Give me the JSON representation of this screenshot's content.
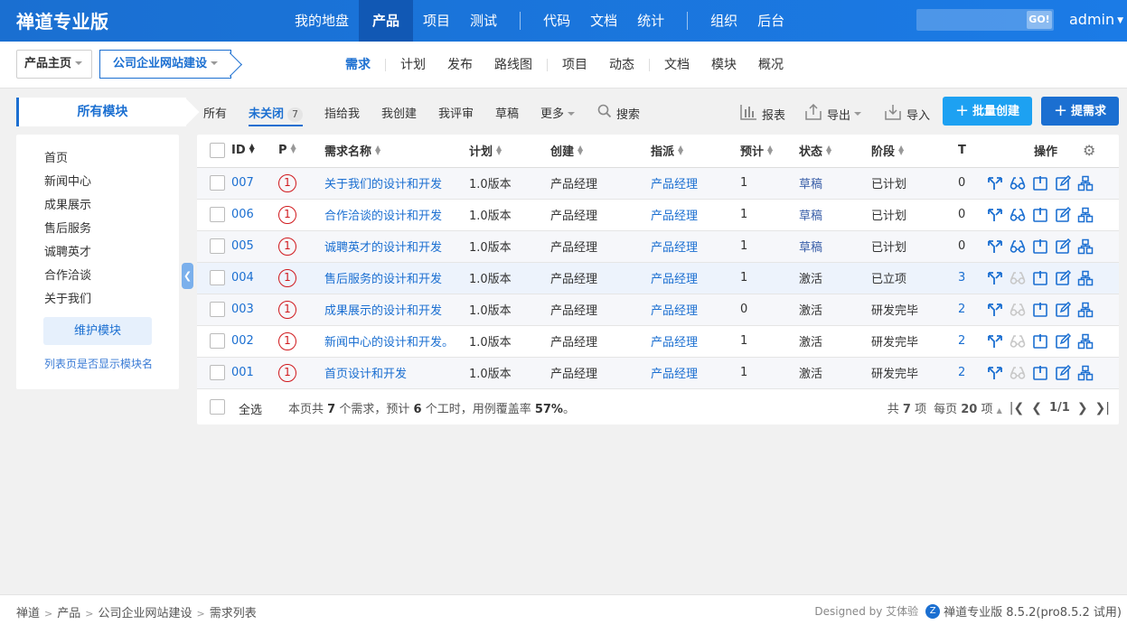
{
  "header": {
    "brand": "禅道专业版",
    "nav": [
      {
        "label": "我的地盘",
        "active": false
      },
      {
        "label": "产品",
        "active": true
      },
      {
        "label": "项目",
        "active": false
      },
      {
        "label": "测试",
        "active": false
      },
      {
        "sep": true
      },
      {
        "label": "代码",
        "active": false
      },
      {
        "label": "文档",
        "active": false
      },
      {
        "label": "统计",
        "active": false
      },
      {
        "sep": true
      },
      {
        "label": "组织",
        "active": false
      },
      {
        "label": "后台",
        "active": false
      }
    ],
    "search_value": "",
    "search_go": "GO!",
    "user": "admin"
  },
  "subheader": {
    "home": "产品主页",
    "product": "公司企业网站建设",
    "tabs": [
      {
        "label": "需求",
        "active": true
      },
      {
        "sep": true
      },
      {
        "label": "计划"
      },
      {
        "label": "发布"
      },
      {
        "label": "路线图"
      },
      {
        "sep": true
      },
      {
        "label": "项目"
      },
      {
        "label": "动态"
      },
      {
        "sep": true
      },
      {
        "label": "文档"
      },
      {
        "label": "模块"
      },
      {
        "label": "概况"
      }
    ]
  },
  "sidebar": {
    "title": "所有模块",
    "modules": [
      "首页",
      "新闻中心",
      "成果展示",
      "售后服务",
      "诚聘英才",
      "合作洽谈",
      "关于我们"
    ],
    "maintain_button": "维护模块",
    "show_module_link": "列表页是否显示模块名"
  },
  "toolbar": {
    "tab_all": "所有",
    "tab_unclosed": "未关闭",
    "unclosed_count": "7",
    "tab_assigned": "指给我",
    "tab_created": "我创建",
    "tab_review": "我评审",
    "tab_draft": "草稿",
    "tab_more": "更多",
    "search": "搜索",
    "report": "报表",
    "export": "导出",
    "import": "导入",
    "batch_create": "批量创建",
    "create": "提需求"
  },
  "table": {
    "headers": {
      "id": "ID",
      "pri": "P",
      "title": "需求名称",
      "plan": "计划",
      "openedBy": "创建",
      "assignedTo": "指派",
      "estimate": "预计",
      "status": "状态",
      "stage": "阶段",
      "tasks": "T",
      "actions": "操作"
    },
    "rows": [
      {
        "id": "007",
        "pri": "1",
        "title": "关于我们的设计和开发",
        "plan": "1.0版本",
        "openedBy": "产品经理",
        "assignedTo": "产品经理",
        "estimate": "1",
        "status": "草稿",
        "stage": "已计划",
        "tasks": "0"
      },
      {
        "id": "006",
        "pri": "1",
        "title": "合作洽谈的设计和开发",
        "plan": "1.0版本",
        "openedBy": "产品经理",
        "assignedTo": "产品经理",
        "estimate": "1",
        "status": "草稿",
        "stage": "已计划",
        "tasks": "0"
      },
      {
        "id": "005",
        "pri": "1",
        "title": "诚聘英才的设计和开发",
        "plan": "1.0版本",
        "openedBy": "产品经理",
        "assignedTo": "产品经理",
        "estimate": "1",
        "status": "草稿",
        "stage": "已计划",
        "tasks": "0"
      },
      {
        "id": "004",
        "pri": "1",
        "title": "售后服务的设计和开发",
        "plan": "1.0版本",
        "openedBy": "产品经理",
        "assignedTo": "产品经理",
        "estimate": "1",
        "status": "激活",
        "stage": "已立项",
        "tasks": "3"
      },
      {
        "id": "003",
        "pri": "1",
        "title": "成果展示的设计和开发",
        "plan": "1.0版本",
        "openedBy": "产品经理",
        "assignedTo": "产品经理",
        "estimate": "0",
        "status": "激活",
        "stage": "研发完毕",
        "tasks": "2"
      },
      {
        "id": "002",
        "pri": "1",
        "title": "新闻中心的设计和开发。",
        "plan": "1.0版本",
        "openedBy": "产品经理",
        "assignedTo": "产品经理",
        "estimate": "1",
        "status": "激活",
        "stage": "研发完毕",
        "tasks": "2"
      },
      {
        "id": "001",
        "pri": "1",
        "title": "首页设计和开发",
        "plan": "1.0版本",
        "openedBy": "产品经理",
        "assignedTo": "产品经理",
        "estimate": "1",
        "status": "激活",
        "stage": "研发完毕",
        "tasks": "2"
      }
    ],
    "select_all": "全选",
    "summary_prefix": "本页共",
    "summary_count": "7",
    "summary_mid": "个需求，预计",
    "summary_hours": "6",
    "summary_mid2": "个工时，用例覆盖率",
    "summary_rate": "57%",
    "summary_end": "。",
    "pager_total_prefix": "共",
    "pager_total": "7",
    "pager_total_suffix": "项",
    "pager_per_prefix": "每页",
    "pager_per": "20",
    "pager_per_suffix": "项",
    "pager_page": "1/1"
  },
  "footer": {
    "crumbs": [
      "禅道",
      "产品",
      "公司企业网站建设",
      "需求列表"
    ],
    "designed_by": "Designed by 艾体验",
    "version": "禅道专业版 8.5.2(pro8.5.2 试用)"
  },
  "colors": {
    "brand_blue": "#1b6fd1",
    "priority_red": "#d0191d",
    "accent_button": "#1da1f2"
  }
}
